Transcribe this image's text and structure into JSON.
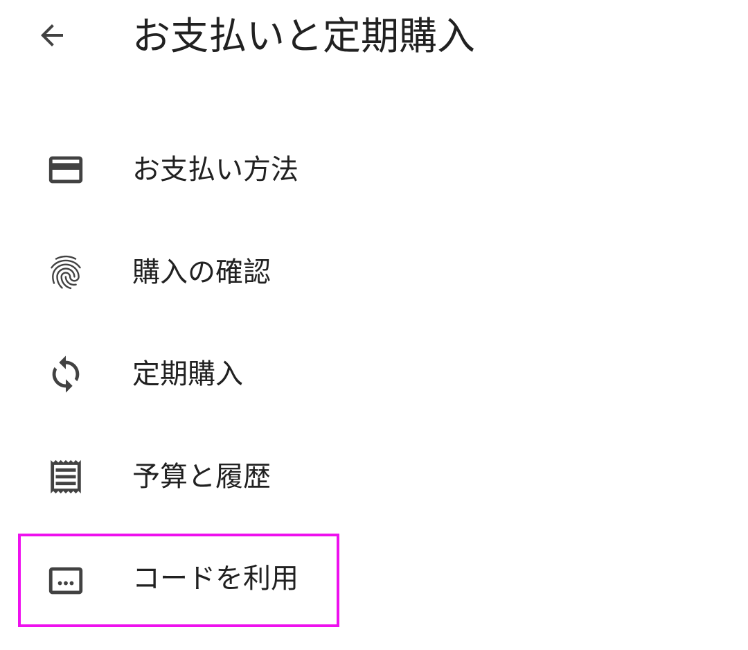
{
  "header": {
    "title": "お支払いと定期購入",
    "back_icon": "arrow-back-icon"
  },
  "menu": {
    "items": [
      {
        "label": "お支払い方法",
        "icon": "credit-card-icon"
      },
      {
        "label": "購入の確認",
        "icon": "fingerprint-icon"
      },
      {
        "label": "定期購入",
        "icon": "sync-icon"
      },
      {
        "label": "予算と履歴",
        "icon": "receipt-icon"
      },
      {
        "label": "コードを利用",
        "icon": "redeem-code-icon"
      }
    ]
  },
  "colors": {
    "text": "#212121",
    "icon": "#424242",
    "highlight": "#ee11ee",
    "background": "#ffffff"
  }
}
